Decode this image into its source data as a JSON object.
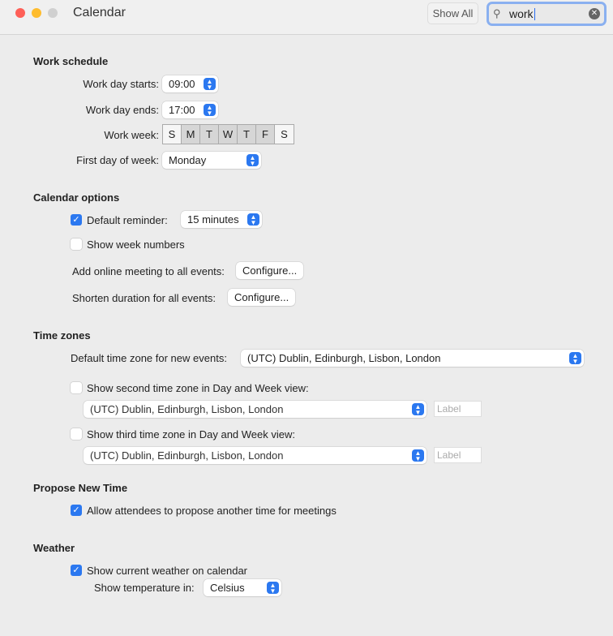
{
  "window": {
    "title": "Calendar",
    "show_all": "Show All",
    "search_value": "work"
  },
  "work_schedule": {
    "heading": "Work schedule",
    "start_label": "Work day starts:",
    "start_value": "09:00",
    "end_label": "Work day ends:",
    "end_value": "17:00",
    "week_label": "Work week:",
    "days": [
      {
        "d": "S",
        "selected": false
      },
      {
        "d": "M",
        "selected": true
      },
      {
        "d": "T",
        "selected": true
      },
      {
        "d": "W",
        "selected": true
      },
      {
        "d": "T",
        "selected": true
      },
      {
        "d": "F",
        "selected": true
      },
      {
        "d": "S",
        "selected": false
      }
    ],
    "first_day_label": "First day of week:",
    "first_day_value": "Monday"
  },
  "calendar_options": {
    "heading": "Calendar options",
    "default_reminder_label": "Default reminder:",
    "default_reminder_checked": true,
    "default_reminder_value": "15 minutes",
    "week_numbers_label": "Show week numbers",
    "week_numbers_checked": false,
    "online_meeting_label": "Add online meeting to all events:",
    "configure": "Configure...",
    "shorten_label": "Shorten duration for all events:"
  },
  "time_zones": {
    "heading": "Time zones",
    "default_label": "Default time zone for new events:",
    "default_value": "(UTC) Dublin, Edinburgh, Lisbon, London",
    "second_label": "Show second time zone in Day and Week view:",
    "second_checked": false,
    "second_value": "(UTC) Dublin, Edinburgh, Lisbon, London",
    "third_label": "Show third time zone in Day and Week view:",
    "third_checked": false,
    "third_value": "(UTC) Dublin, Edinburgh, Lisbon, London",
    "label_placeholder": "Label"
  },
  "propose": {
    "heading": "Propose New Time",
    "allow_label": "Allow attendees to propose another time for meetings",
    "allow_checked": true
  },
  "weather": {
    "heading": "Weather",
    "show_label": "Show current weather on calendar",
    "show_checked": true,
    "temp_label": "Show temperature in:",
    "temp_value": "Celsius"
  },
  "colors": {
    "accent": "#2b78f0",
    "close": "#fe5f57",
    "minimize": "#febc2e",
    "disabled": "#d0d0d0"
  }
}
